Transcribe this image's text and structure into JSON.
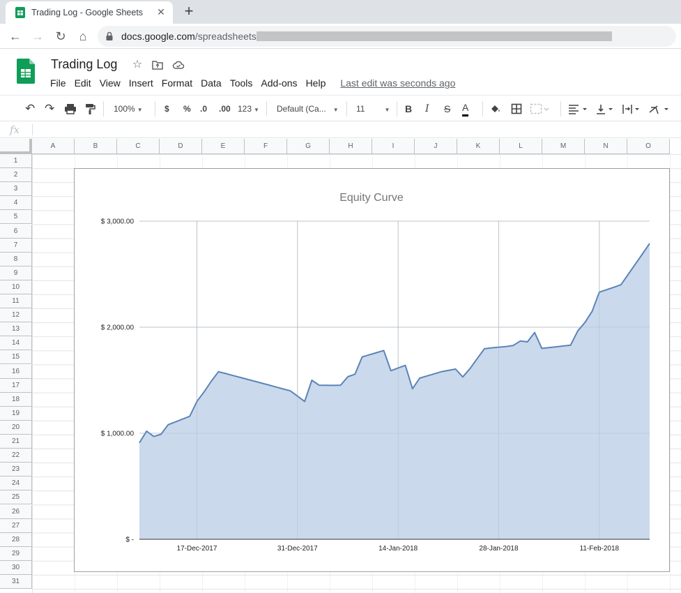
{
  "browser": {
    "tab_title": "Trading Log - Google Sheets",
    "new_tab": "+",
    "url_host": "docs.google.com",
    "url_path": "/spreadsheets/"
  },
  "app": {
    "doc_title": "Trading Log",
    "menu": [
      "File",
      "Edit",
      "View",
      "Insert",
      "Format",
      "Data",
      "Tools",
      "Add-ons",
      "Help"
    ],
    "last_edit": "Last edit was seconds ago",
    "brand_color": "#0f9d58"
  },
  "toolbar": {
    "zoom": "100%",
    "currency": "$",
    "percent": "%",
    "decrease_decimal": ".0",
    "increase_decimal": ".00",
    "more_formats": "123",
    "font": "Default (Ca...",
    "font_size": "11",
    "bold": "B",
    "italic": "I",
    "strike": "S",
    "text_color": "A"
  },
  "formula_bar": {
    "fx": "fx",
    "value": ""
  },
  "columns": [
    "A",
    "B",
    "C",
    "D",
    "E",
    "F",
    "G",
    "H",
    "I",
    "J",
    "K",
    "L",
    "M",
    "N",
    "O"
  ],
  "rows": [
    "1",
    "2",
    "3",
    "4",
    "5",
    "6",
    "7",
    "8",
    "9",
    "10",
    "11",
    "12",
    "13",
    "14",
    "15",
    "16",
    "17",
    "18",
    "19",
    "20",
    "21",
    "22",
    "23",
    "24",
    "25",
    "26",
    "27",
    "28",
    "29",
    "30",
    "31"
  ],
  "chart_data": {
    "type": "area",
    "title": "Equity Curve",
    "xlabel": "",
    "ylabel": "",
    "ylim": [
      0,
      3000
    ],
    "y_ticks": [
      "$ -",
      "$ 1,000.00",
      "$ 2,000.00",
      "$ 3,000.00"
    ],
    "y_tick_values": [
      0,
      1000,
      2000,
      3000
    ],
    "x_ticks": [
      "17-Dec-2017",
      "31-Dec-2017",
      "14-Jan-2018",
      "28-Jan-2018",
      "11-Feb-2018"
    ],
    "grid": true,
    "line_color": "#5a84b8",
    "fill_color": "#cbd9ec",
    "series": [
      {
        "name": "",
        "x": [
          "2017-12-09",
          "2017-12-10",
          "2017-12-11",
          "2017-12-12",
          "2017-12-13",
          "2017-12-16",
          "2017-12-17",
          "2017-12-18",
          "2017-12-19",
          "2017-12-20",
          "2017-12-21",
          "2017-12-22",
          "2017-12-23",
          "2017-12-24",
          "2017-12-25",
          "2017-12-26",
          "2017-12-27",
          "2017-12-28",
          "2017-12-29",
          "2017-12-30",
          "2018-01-01",
          "2018-01-02",
          "2018-01-03",
          "2018-01-04",
          "2018-01-05",
          "2018-01-06",
          "2018-01-07",
          "2018-01-08",
          "2018-01-09",
          "2018-01-11",
          "2018-01-12",
          "2018-01-13",
          "2018-01-15",
          "2018-01-16",
          "2018-01-17",
          "2018-01-18",
          "2018-01-19",
          "2018-01-20",
          "2018-01-22",
          "2018-01-23",
          "2018-01-24",
          "2018-01-25",
          "2018-01-26",
          "2018-01-27",
          "2018-01-28",
          "2018-01-29",
          "2018-01-30",
          "2018-01-31",
          "2018-02-01",
          "2018-02-02",
          "2018-02-03",
          "2018-02-04",
          "2018-02-05",
          "2018-02-06",
          "2018-02-07",
          "2018-02-08",
          "2018-02-09",
          "2018-02-10",
          "2018-02-11",
          "2018-02-12",
          "2018-02-13",
          "2018-02-14",
          "2018-02-15",
          "2018-02-16",
          "2018-02-17",
          "2018-02-18"
        ],
        "values": [
          910,
          1020,
          970,
          990,
          1080,
          1160,
          1300,
          1390,
          1490,
          1580,
          1563,
          1545,
          1527,
          1509,
          1491,
          1473,
          1455,
          1436,
          1418,
          1400,
          1300,
          1500,
          1453,
          1452,
          1451,
          1453,
          1533,
          1557,
          1720,
          1760,
          1780,
          1590,
          1640,
          1420,
          1520,
          1540,
          1560,
          1580,
          1605,
          1531,
          1610,
          1703,
          1797,
          1805,
          1812,
          1818,
          1827,
          1870,
          1862,
          1950,
          1800,
          1808,
          1815,
          1823,
          1831,
          1965,
          2045,
          2150,
          2330,
          2353,
          2376,
          2400,
          2497,
          2594,
          2691,
          2790
        ]
      }
    ]
  }
}
